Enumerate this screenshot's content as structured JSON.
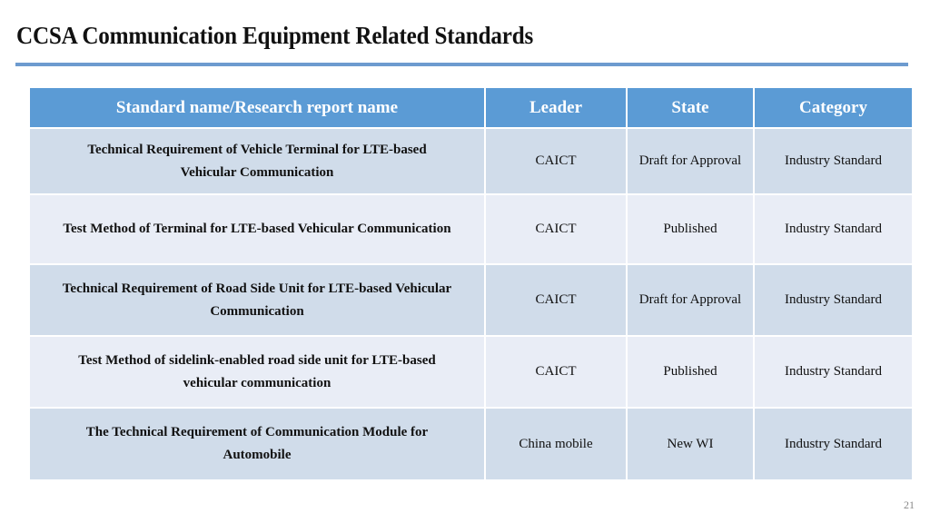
{
  "slide": {
    "title": "CCSA Communication Equipment Related Standards",
    "page_number": "21",
    "accent_color": "#5b9bd5"
  },
  "table": {
    "headers": [
      "Standard name/Research report name",
      "Leader",
      "State",
      "Category"
    ],
    "rows": [
      {
        "name": "Technical Requirement of  Vehicle Terminal for LTE-based Vehicular Communication",
        "leader": "CAICT",
        "state": "Draft for Approval",
        "category": "Industry Standard"
      },
      {
        "name": "Test Method of Terminal for LTE-based Vehicular Communication",
        "leader": "CAICT",
        "state": "Published",
        "category": "Industry Standard"
      },
      {
        "name": "Technical Requirement of Road Side Unit for LTE-based Vehicular Communication",
        "leader": "CAICT",
        "state": "Draft for Approval",
        "category": "Industry Standard"
      },
      {
        "name": "Test Method of sidelink-enabled road side unit for LTE-based vehicular communication",
        "leader": "CAICT",
        "state": "Published",
        "category": "Industry Standard"
      },
      {
        "name": "The Technical Requirement of Communication Module for Automobile",
        "leader": "China mobile",
        "state": "New WI",
        "category": "Industry Standard"
      }
    ]
  }
}
